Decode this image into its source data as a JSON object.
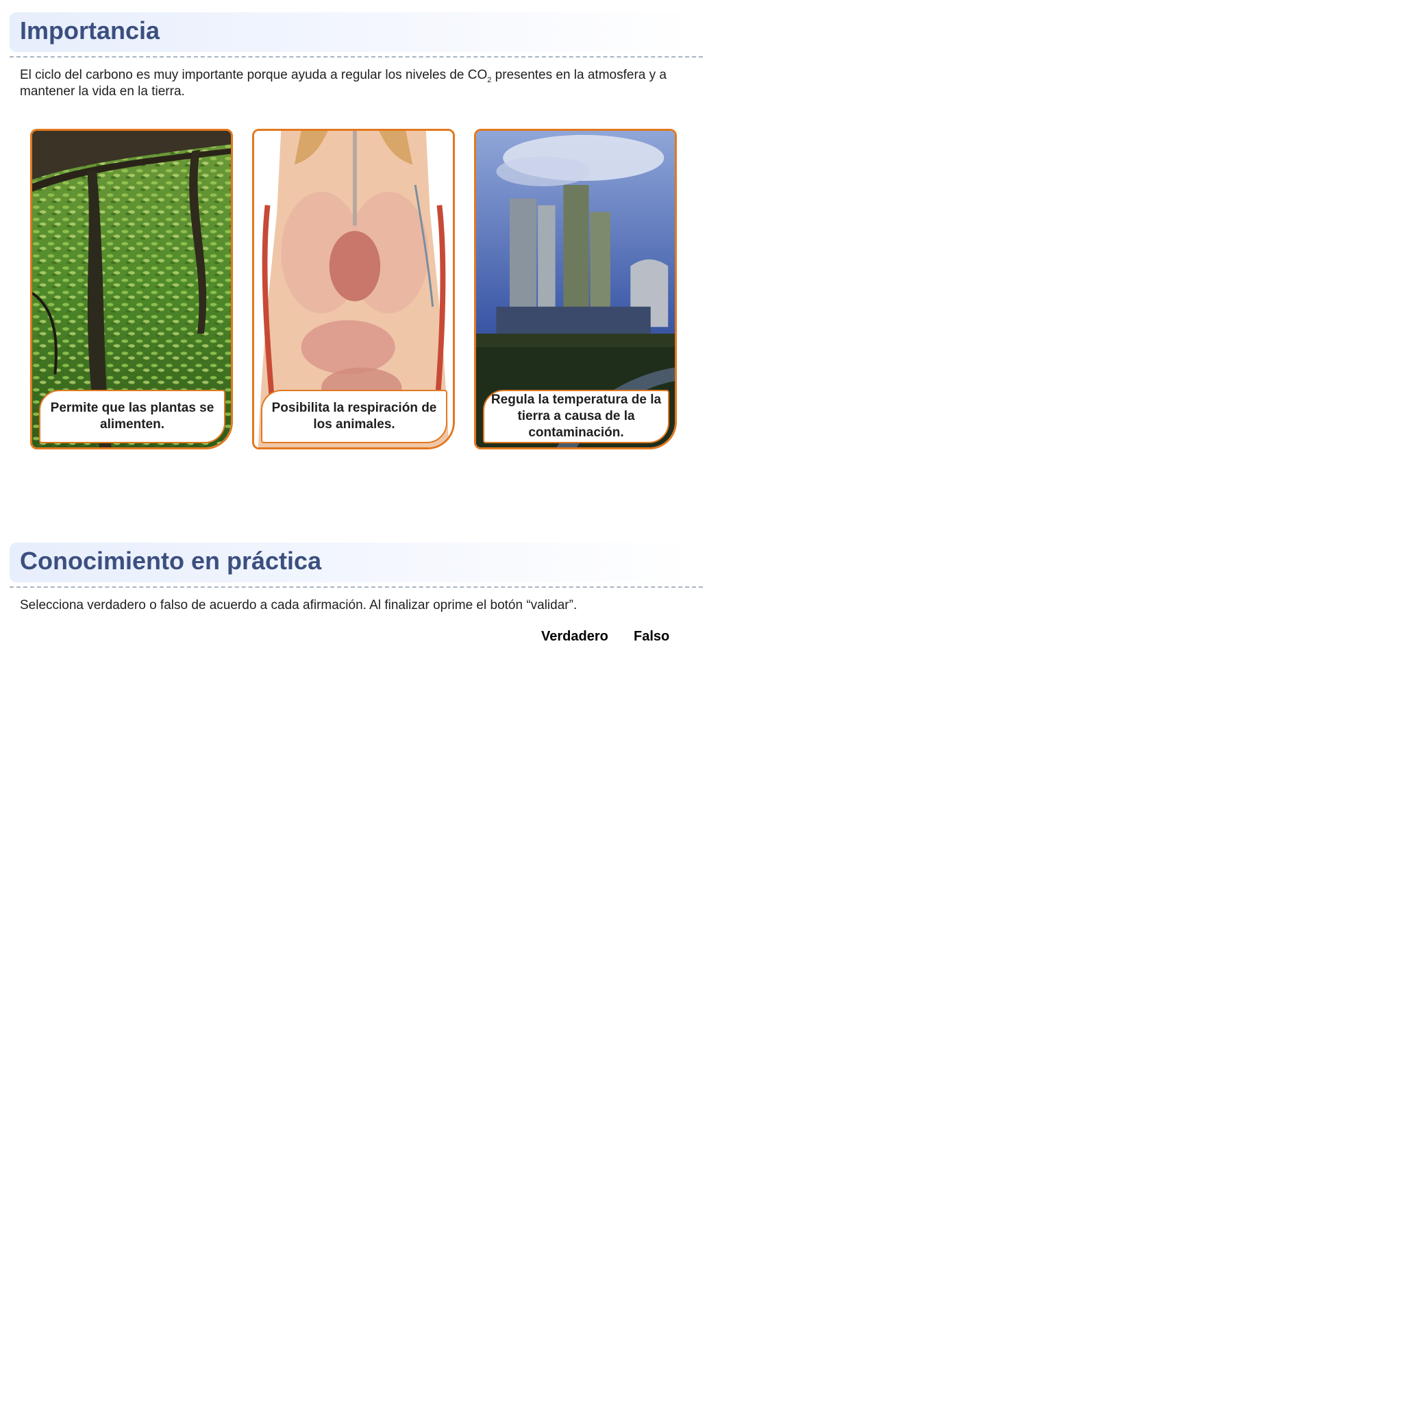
{
  "importancia": {
    "title": "Importancia",
    "paragraph_before_sub": "El ciclo del carbono es muy importante porque ayuda a regular los niveles de CO",
    "paragraph_sub": "2",
    "paragraph_after_sub": " presentes en la atmosfera y a mantener la vida en la tierra.",
    "cards": [
      {
        "photo": "forest-trees-photo",
        "caption": "Permite que las plantas se alimenten."
      },
      {
        "photo": "human-anatomy-organs-photo",
        "caption": "Posibilita la respiración de los animales."
      },
      {
        "photo": "industrial-plant-smoke-photo",
        "caption": "Regula la temperatura de la tierra a causa de la contaminación."
      }
    ]
  },
  "practica": {
    "title": "Conocimiento en práctica",
    "instructions": "Selecciona verdadero o falso de acuerdo a cada afirmación. Al finalizar oprime el botón “validar”.",
    "col_true": "Verdadero",
    "col_false": "Falso"
  },
  "colors": {
    "heading": "#3b4f7f",
    "header_bg": "#e7eefc",
    "card_border": "#e2781f",
    "rule": "#a9b3c4"
  }
}
